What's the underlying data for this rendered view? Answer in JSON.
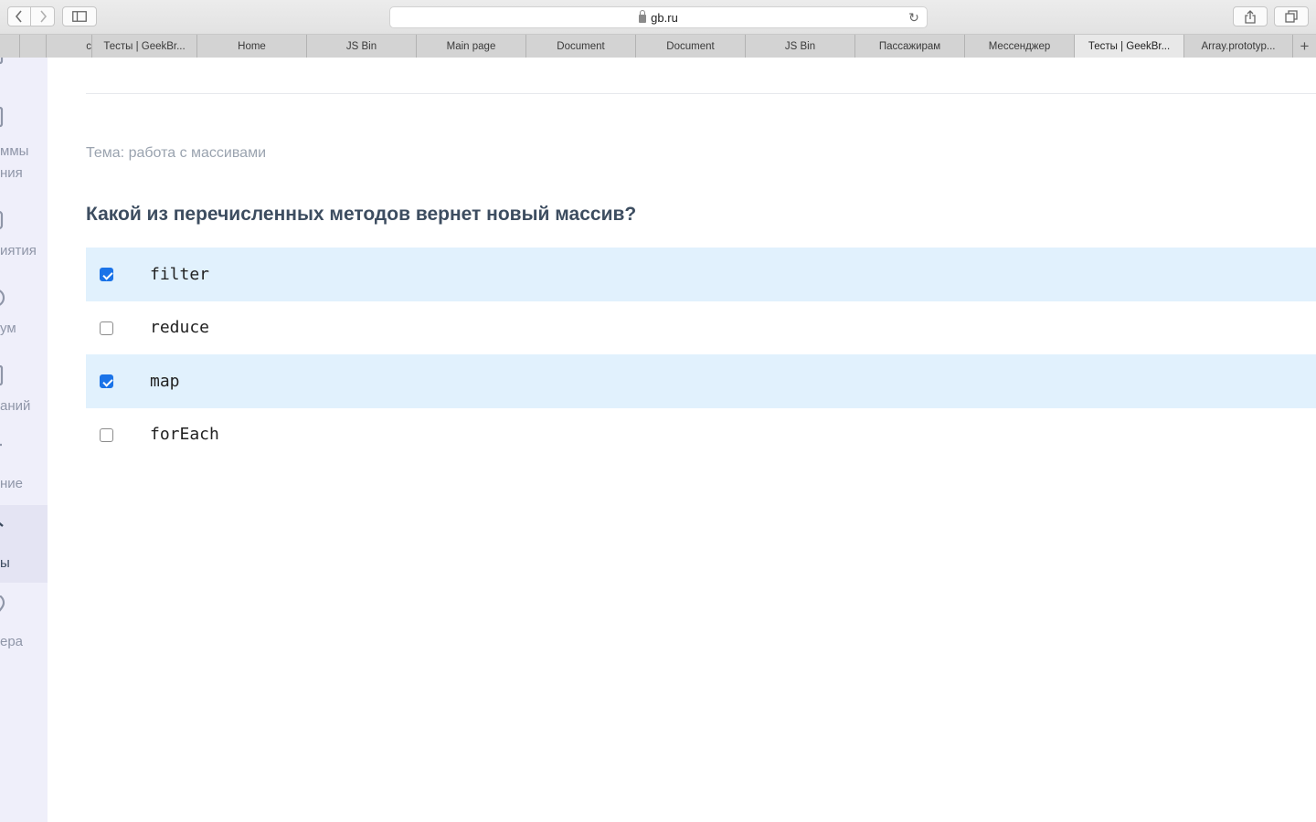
{
  "browser": {
    "url": "gb.ru",
    "tabs": [
      {
        "label": "",
        "active": false
      },
      {
        "label": "",
        "active": false
      },
      {
        "label": "с",
        "active": false
      },
      {
        "label": "Тесты | GeekBr...",
        "active": false
      },
      {
        "label": "Home",
        "active": false
      },
      {
        "label": "JS Bin",
        "active": false
      },
      {
        "label": "Main page",
        "active": false
      },
      {
        "label": "Document",
        "active": false
      },
      {
        "label": "Document",
        "active": false
      },
      {
        "label": "JS Bin",
        "active": false
      },
      {
        "label": "Пассажирам",
        "active": false
      },
      {
        "label": "Мессенджер",
        "active": false
      },
      {
        "label": "Тесты | GeekBr...",
        "active": true
      },
      {
        "label": "Array.prototyp...",
        "active": false
      }
    ],
    "new_tab_label": "+"
  },
  "sidebar": {
    "items": [
      {
        "label_line1": "",
        "label_line2": "",
        "icon": "monitor-icon"
      },
      {
        "label_line1": "ммы",
        "label_line2": "ния",
        "icon": "book-icon"
      },
      {
        "label_line1": "иятия",
        "label_line2": "",
        "icon": "calendar-icon"
      },
      {
        "label_line1": "ум",
        "label_line2": "",
        "icon": "chat-icon"
      },
      {
        "label_line1": "аний",
        "label_line2": "",
        "icon": "tasks-icon"
      },
      {
        "label_line1": "ние",
        "label_line2": "",
        "icon": "education-icon"
      },
      {
        "label_line1": "ы",
        "label_line2": "",
        "icon": "tests-icon",
        "active": true
      },
      {
        "label_line1": "ера",
        "label_line2": "",
        "icon": "career-icon"
      }
    ]
  },
  "quiz": {
    "topic": "Тема: работа с массивами",
    "question": "Какой из перечисленных методов вернет новый массив?",
    "options": [
      {
        "label": "filter",
        "checked": true
      },
      {
        "label": "reduce",
        "checked": false
      },
      {
        "label": "map",
        "checked": true
      },
      {
        "label": "forEach",
        "checked": false
      }
    ]
  }
}
